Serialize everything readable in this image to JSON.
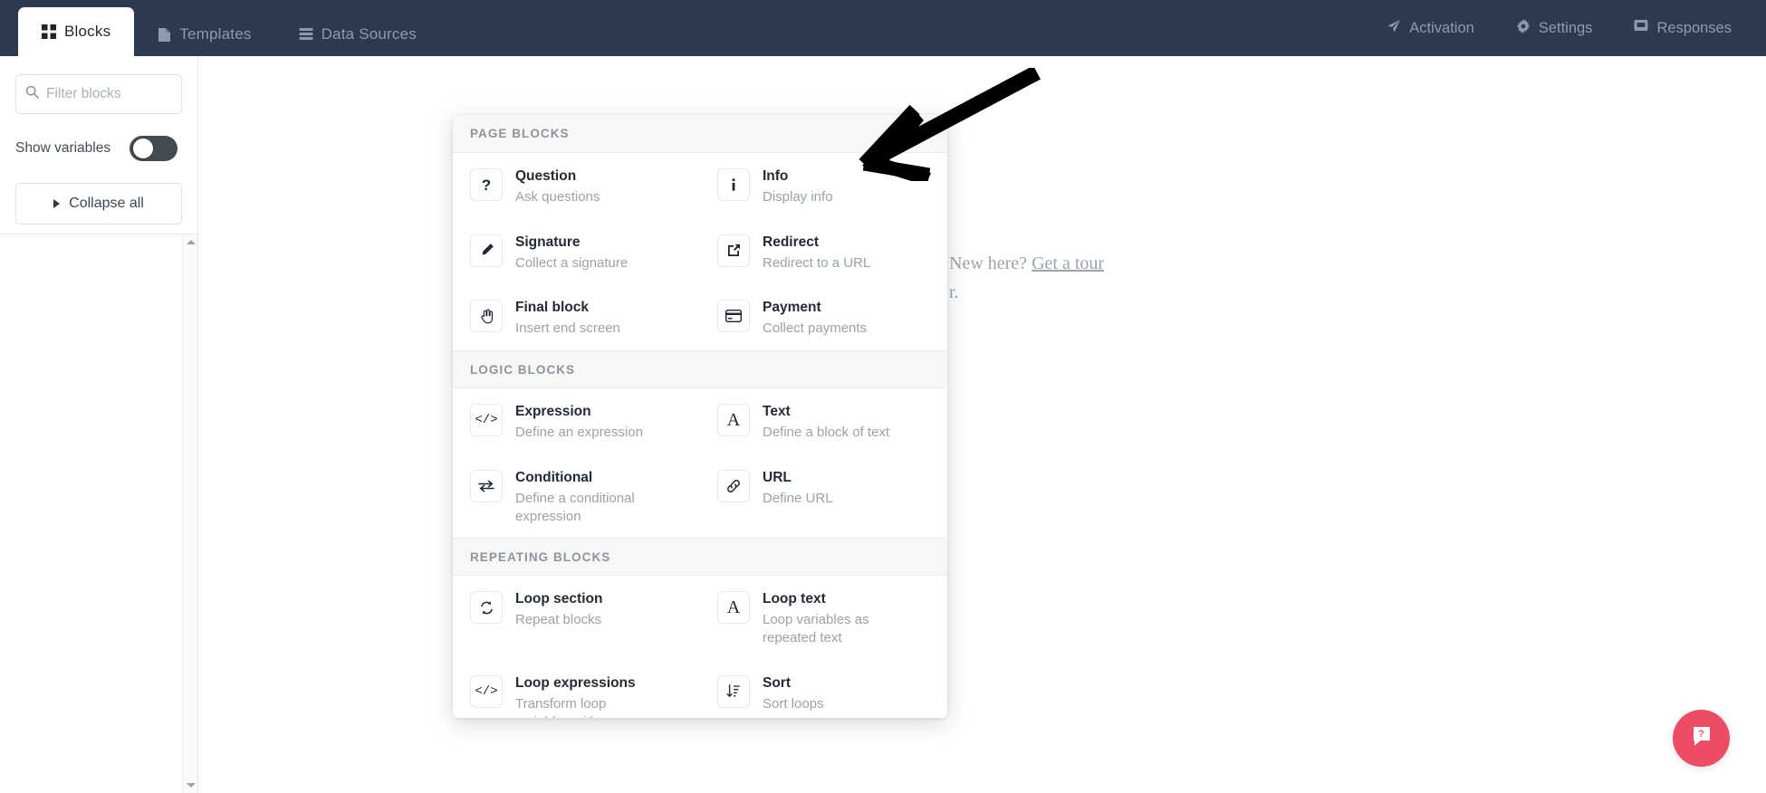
{
  "topbar": {
    "tabs": [
      {
        "label": "Blocks",
        "icon": "grid-icon",
        "active": true
      },
      {
        "label": "Templates",
        "icon": "file-icon",
        "active": false
      },
      {
        "label": "Data Sources",
        "icon": "database-icon",
        "active": false
      }
    ],
    "right_items": [
      {
        "label": "Activation",
        "icon": "rocket-icon"
      },
      {
        "label": "Settings",
        "icon": "gear-icon"
      },
      {
        "label": "Responses",
        "icon": "inbox-icon"
      }
    ]
  },
  "sidebar": {
    "filter": {
      "placeholder": "Filter blocks",
      "value": "",
      "icon": "search-icon"
    },
    "show_variables": {
      "label": "Show variables",
      "state": "off"
    },
    "collapse_all": {
      "label": "Collapse all",
      "icon": "caret-right-icon"
    }
  },
  "canvas": {
    "tour_text_prefix": "New here? ",
    "tour_link": "Get a tour",
    "secondary_text": "r."
  },
  "popup": {
    "sections": [
      {
        "title": "PAGE BLOCKS",
        "items": [
          {
            "title": "Question",
            "desc": "Ask questions",
            "icon": "question-mark-icon"
          },
          {
            "title": "Info",
            "desc": "Display info",
            "icon": "info-icon"
          },
          {
            "title": "Signature",
            "desc": "Collect a signature",
            "icon": "pencil-icon"
          },
          {
            "title": "Redirect",
            "desc": "Redirect to a URL",
            "icon": "external-link-icon"
          },
          {
            "title": "Final block",
            "desc": "Insert end screen",
            "icon": "hand-pointer-icon"
          },
          {
            "title": "Payment",
            "desc": "Collect payments",
            "icon": "credit-card-icon"
          }
        ]
      },
      {
        "title": "LOGIC BLOCKS",
        "items": [
          {
            "title": "Expression",
            "desc": "Define an expression",
            "icon": "code-icon"
          },
          {
            "title": "Text",
            "desc": "Define a block of text",
            "icon": "letter-a-icon"
          },
          {
            "title": "Conditional",
            "desc": "Define a conditional expression",
            "icon": "swap-arrows-icon"
          },
          {
            "title": "URL",
            "desc": "Define URL",
            "icon": "link-icon"
          }
        ]
      },
      {
        "title": "REPEATING BLOCKS",
        "items": [
          {
            "title": "Loop section",
            "desc": "Repeat blocks",
            "icon": "refresh-icon"
          },
          {
            "title": "Loop text",
            "desc": "Loop variables as repeated text",
            "icon": "letter-a-icon"
          },
          {
            "title": "Loop expressions",
            "desc": "Transform loop variables with expressions",
            "icon": "code-icon"
          },
          {
            "title": "Sort",
            "desc": "Sort loops",
            "icon": "sort-icon"
          }
        ]
      }
    ]
  },
  "help": {
    "icon": "help-chat-icon"
  },
  "annotation": {
    "type": "arrow",
    "color": "#000000",
    "points_to": "Info"
  },
  "colors": {
    "topbar_bg": "#2b3a4f",
    "topbar_text": "#8e9bac",
    "accent_help": "#ec4c64",
    "section_bg": "#f7f7f8",
    "muted_text": "#9aa2ab"
  }
}
